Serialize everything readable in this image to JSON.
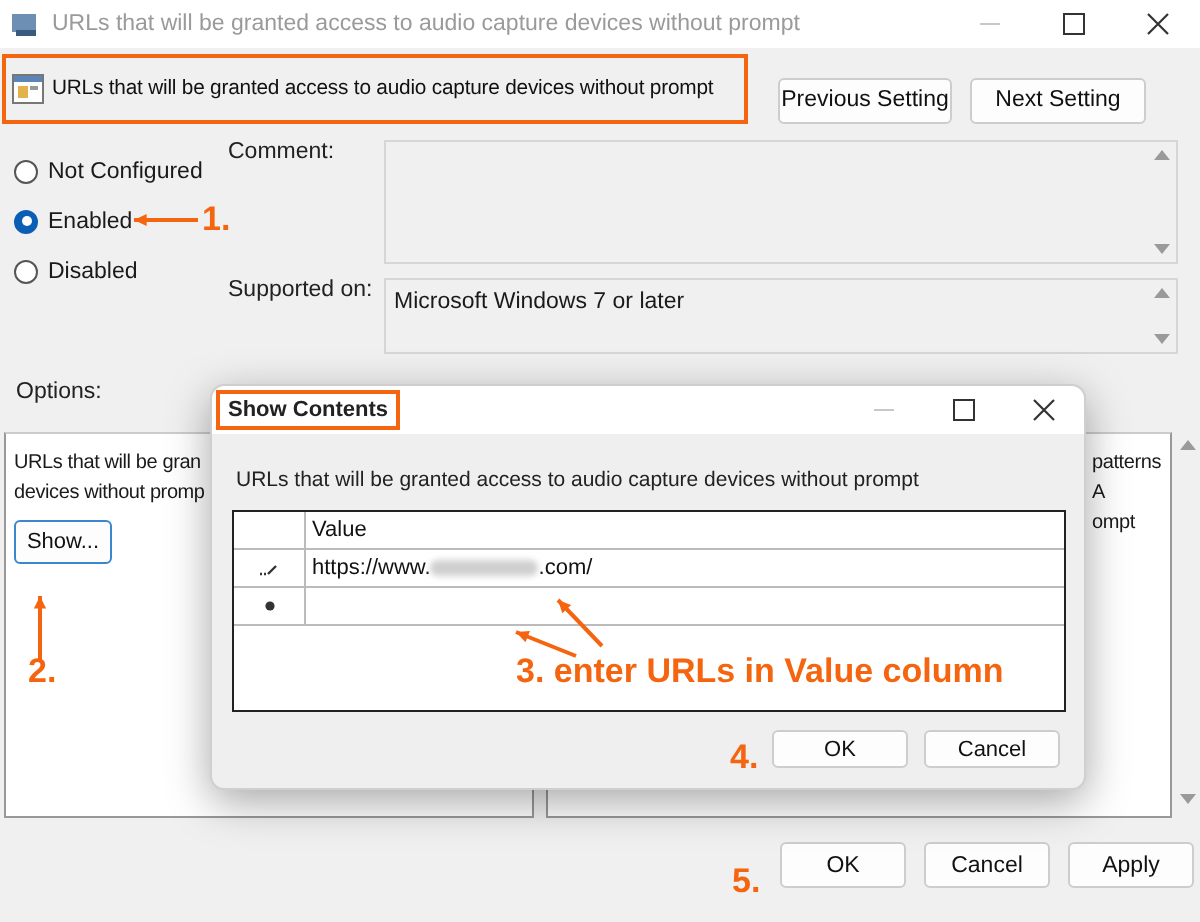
{
  "window": {
    "title": "URLs that will be granted access to audio capture devices without prompt"
  },
  "policy": {
    "title": "URLs that will be granted access to audio capture devices without prompt"
  },
  "nav_buttons": [
    "Previous Setting",
    "Next Setting"
  ],
  "state_options": [
    {
      "label": "Not Configured",
      "selected": false
    },
    {
      "label": "Enabled",
      "selected": true
    },
    {
      "label": "Disabled",
      "selected": false
    }
  ],
  "comment": {
    "label": "Comment:"
  },
  "supported_on": {
    "label": "Supported on:",
    "value": "Microsoft Windows 7 or later"
  },
  "options": {
    "label": "Options:",
    "lines": [
      "URLs that will be gran",
      "devices without promp"
    ],
    "show_button": "Show..."
  },
  "help": {
    "lines": [
      "patterns",
      "A",
      "ompt"
    ]
  },
  "dialog_buttons": [
    "OK",
    "Cancel",
    "Apply"
  ],
  "show_contents": {
    "title": "Show Contents",
    "description": "URLs that will be granted access to audio capture devices without prompt",
    "columns": [
      "Value"
    ],
    "rows": [
      {
        "kind": "edit",
        "value_prefix": "https://www.",
        "value_suffix": ".com/",
        "redacted": true
      },
      {
        "kind": "new"
      }
    ],
    "buttons": [
      "OK",
      "Cancel"
    ]
  },
  "annotations": [
    {
      "label": "1."
    },
    {
      "label": "2."
    },
    {
      "label": "3. enter URLs in Value column"
    },
    {
      "label": "4."
    },
    {
      "label": "5."
    }
  ]
}
